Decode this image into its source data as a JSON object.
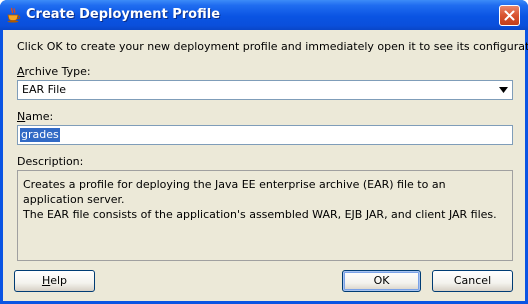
{
  "window": {
    "title": "Create Deployment Profile",
    "icon": "java-cup-icon"
  },
  "intro_text": "Click OK to create your new deployment profile and immediately open it to see its configuration.",
  "archive_type": {
    "label_mnemonic": "A",
    "label_rest": "rchive Type:",
    "selected": "EAR File"
  },
  "name_field": {
    "label_mnemonic": "N",
    "label_rest": "ame:",
    "value": "grades"
  },
  "description": {
    "label": "Description:",
    "text_line1": "Creates a profile for deploying the Java EE enterprise archive (EAR) file to an application server.",
    "text_line2": "The EAR file consists of the application's assembled WAR, EJB JAR, and client JAR files."
  },
  "buttons": {
    "help_mnemonic": "H",
    "help_rest": "elp",
    "ok": "OK",
    "cancel": "Cancel"
  },
  "colors": {
    "titlebar": "#0a54e3",
    "dialog_bg": "#ece9d8",
    "selection": "#316ac5",
    "close_button": "#d9532f"
  }
}
